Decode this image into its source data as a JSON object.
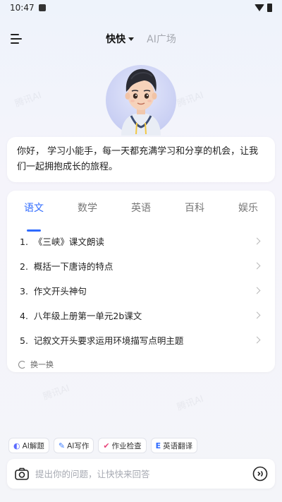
{
  "status_bar": {
    "time": "10:47"
  },
  "header": {
    "active_tab": "快快",
    "other_tab": "AI广场"
  },
  "greeting": "你好， 学习小能手，每一天都充满学习和分享的机会，让我们一起拥抱成长的旅程。",
  "subjects": [
    "语文",
    "数学",
    "英语",
    "百科",
    "娱乐"
  ],
  "active_subject_index": 0,
  "topics": [
    {
      "number": "1.",
      "title": "《三峡》课文朗读"
    },
    {
      "number": "2.",
      "title": "概括一下唐诗的特点"
    },
    {
      "number": "3.",
      "title": "作文开头神句"
    },
    {
      "number": "4.",
      "title": "八年级上册第一单元2b课文"
    },
    {
      "number": "5.",
      "title": "记叙文开头要求运用环境描写点明主题"
    }
  ],
  "refresh_label": "换一换",
  "tools": [
    {
      "label": "AI解题",
      "icon": "ai-solve-icon",
      "color": "#5b6bff"
    },
    {
      "label": "AI写作",
      "icon": "ai-write-icon",
      "color": "#3b7bff"
    },
    {
      "label": "作业检查",
      "icon": "check-icon",
      "color": "#e8457a"
    },
    {
      "label": "英语翻译",
      "icon": "translate-icon",
      "color": "#2f6bff"
    }
  ],
  "input": {
    "placeholder": "提出你的问题，让快快来回答"
  },
  "colors": {
    "accent": "#2f6bff"
  }
}
